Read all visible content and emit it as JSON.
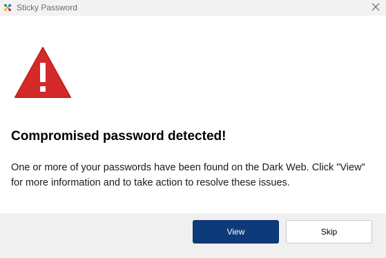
{
  "window": {
    "title": "Sticky Password"
  },
  "alert": {
    "heading": "Compromised password detected!",
    "line1": "One or more of your passwords have been found on the Dark Web. Click \"View\"",
    "line2": "for more information and to take action to resolve these issues."
  },
  "actions": {
    "view_label": "View",
    "skip_label": "Skip"
  },
  "icons": {
    "app": "sticky-password-logo-icon",
    "close": "close-icon",
    "warning": "warning-triangle-icon"
  },
  "colors": {
    "warning_red": "#d42a2a",
    "primary_button": "#0d3a7a",
    "footer_bg": "#f0f0f0",
    "titlebar_bg": "#f3f3f3"
  }
}
